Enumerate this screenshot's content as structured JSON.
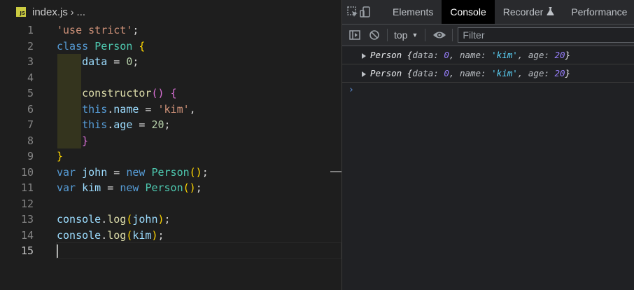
{
  "editor": {
    "breadcrumb": {
      "file_icon": "JS",
      "file": "index.js",
      "separator": "›",
      "rest": "..."
    },
    "lines": [
      {
        "n": "1",
        "tokens": [
          {
            "t": "'use strict'",
            "c": "t-str"
          },
          {
            "t": ";",
            "c": "t-plain"
          }
        ]
      },
      {
        "n": "2",
        "tokens": [
          {
            "t": "class ",
            "c": "t-kw"
          },
          {
            "t": "Person",
            "c": "t-cls"
          },
          {
            "t": " ",
            "c": "t-plain"
          },
          {
            "t": "{",
            "c": "t-br1"
          }
        ]
      },
      {
        "n": "3",
        "tokens": [
          {
            "t": "    ",
            "c": "t-plain"
          },
          {
            "t": "data",
            "c": "t-prop"
          },
          {
            "t": " = ",
            "c": "t-plain"
          },
          {
            "t": "0",
            "c": "t-num"
          },
          {
            "t": ";",
            "c": "t-plain"
          }
        ]
      },
      {
        "n": "4",
        "tokens": []
      },
      {
        "n": "5",
        "tokens": [
          {
            "t": "    ",
            "c": "t-plain"
          },
          {
            "t": "constructor",
            "c": "t-fn"
          },
          {
            "t": "()",
            "c": "t-br2"
          },
          {
            "t": " ",
            "c": "t-plain"
          },
          {
            "t": "{",
            "c": "t-br2"
          }
        ]
      },
      {
        "n": "6",
        "tokens": [
          {
            "t": "    ",
            "c": "t-plain"
          },
          {
            "t": "this",
            "c": "t-kw"
          },
          {
            "t": ".",
            "c": "t-plain"
          },
          {
            "t": "name",
            "c": "t-prop"
          },
          {
            "t": " = ",
            "c": "t-plain"
          },
          {
            "t": "'kim'",
            "c": "t-str"
          },
          {
            "t": ",",
            "c": "t-plain"
          }
        ]
      },
      {
        "n": "7",
        "tokens": [
          {
            "t": "    ",
            "c": "t-plain"
          },
          {
            "t": "this",
            "c": "t-kw"
          },
          {
            "t": ".",
            "c": "t-plain"
          },
          {
            "t": "age",
            "c": "t-prop"
          },
          {
            "t": " = ",
            "c": "t-plain"
          },
          {
            "t": "20",
            "c": "t-num"
          },
          {
            "t": ";",
            "c": "t-plain"
          }
        ]
      },
      {
        "n": "8",
        "tokens": [
          {
            "t": "    ",
            "c": "t-plain"
          },
          {
            "t": "}",
            "c": "t-br2"
          }
        ]
      },
      {
        "n": "9",
        "tokens": [
          {
            "t": "}",
            "c": "t-br1"
          }
        ]
      },
      {
        "n": "10",
        "tokens": [
          {
            "t": "var ",
            "c": "t-kw"
          },
          {
            "t": "john",
            "c": "t-prop"
          },
          {
            "t": " = ",
            "c": "t-plain"
          },
          {
            "t": "new ",
            "c": "t-kw"
          },
          {
            "t": "Person",
            "c": "t-cls"
          },
          {
            "t": "()",
            "c": "t-br1"
          },
          {
            "t": ";",
            "c": "t-plain"
          }
        ]
      },
      {
        "n": "11",
        "tokens": [
          {
            "t": "var ",
            "c": "t-kw"
          },
          {
            "t": "kim",
            "c": "t-prop"
          },
          {
            "t": " = ",
            "c": "t-plain"
          },
          {
            "t": "new ",
            "c": "t-kw"
          },
          {
            "t": "Person",
            "c": "t-cls"
          },
          {
            "t": "()",
            "c": "t-br1"
          },
          {
            "t": ";",
            "c": "t-plain"
          }
        ]
      },
      {
        "n": "12",
        "tokens": []
      },
      {
        "n": "13",
        "tokens": [
          {
            "t": "console",
            "c": "t-prop"
          },
          {
            "t": ".",
            "c": "t-plain"
          },
          {
            "t": "log",
            "c": "t-fn"
          },
          {
            "t": "(",
            "c": "t-br1"
          },
          {
            "t": "john",
            "c": "t-prop"
          },
          {
            "t": ")",
            "c": "t-br1"
          },
          {
            "t": ";",
            "c": "t-plain"
          }
        ]
      },
      {
        "n": "14",
        "tokens": [
          {
            "t": "console",
            "c": "t-prop"
          },
          {
            "t": ".",
            "c": "t-plain"
          },
          {
            "t": "log",
            "c": "t-fn"
          },
          {
            "t": "(",
            "c": "t-br1"
          },
          {
            "t": "kim",
            "c": "t-prop"
          },
          {
            "t": ")",
            "c": "t-br1"
          },
          {
            "t": ";",
            "c": "t-plain"
          }
        ]
      },
      {
        "n": "15",
        "tokens": [],
        "active": true
      }
    ]
  },
  "devtools": {
    "tabs": [
      {
        "label": "Elements",
        "active": false
      },
      {
        "label": "Console",
        "active": true
      },
      {
        "label": "Recorder",
        "active": false,
        "icon": "flask-icon"
      },
      {
        "label": "Performance",
        "active": false
      }
    ],
    "toolbar": {
      "context": "top",
      "filter_placeholder": "Filter"
    },
    "messages": [
      {
        "name": "Person",
        "fields": [
          {
            "k": "data",
            "v": "0",
            "type": "num"
          },
          {
            "k": "name",
            "v": "'kim'",
            "type": "str"
          },
          {
            "k": "age",
            "v": "20",
            "type": "num"
          }
        ]
      },
      {
        "name": "Person",
        "fields": [
          {
            "k": "data",
            "v": "0",
            "type": "num"
          },
          {
            "k": "name",
            "v": "'kim'",
            "type": "str"
          },
          {
            "k": "age",
            "v": "20",
            "type": "num"
          }
        ]
      }
    ],
    "prompt": "›"
  }
}
